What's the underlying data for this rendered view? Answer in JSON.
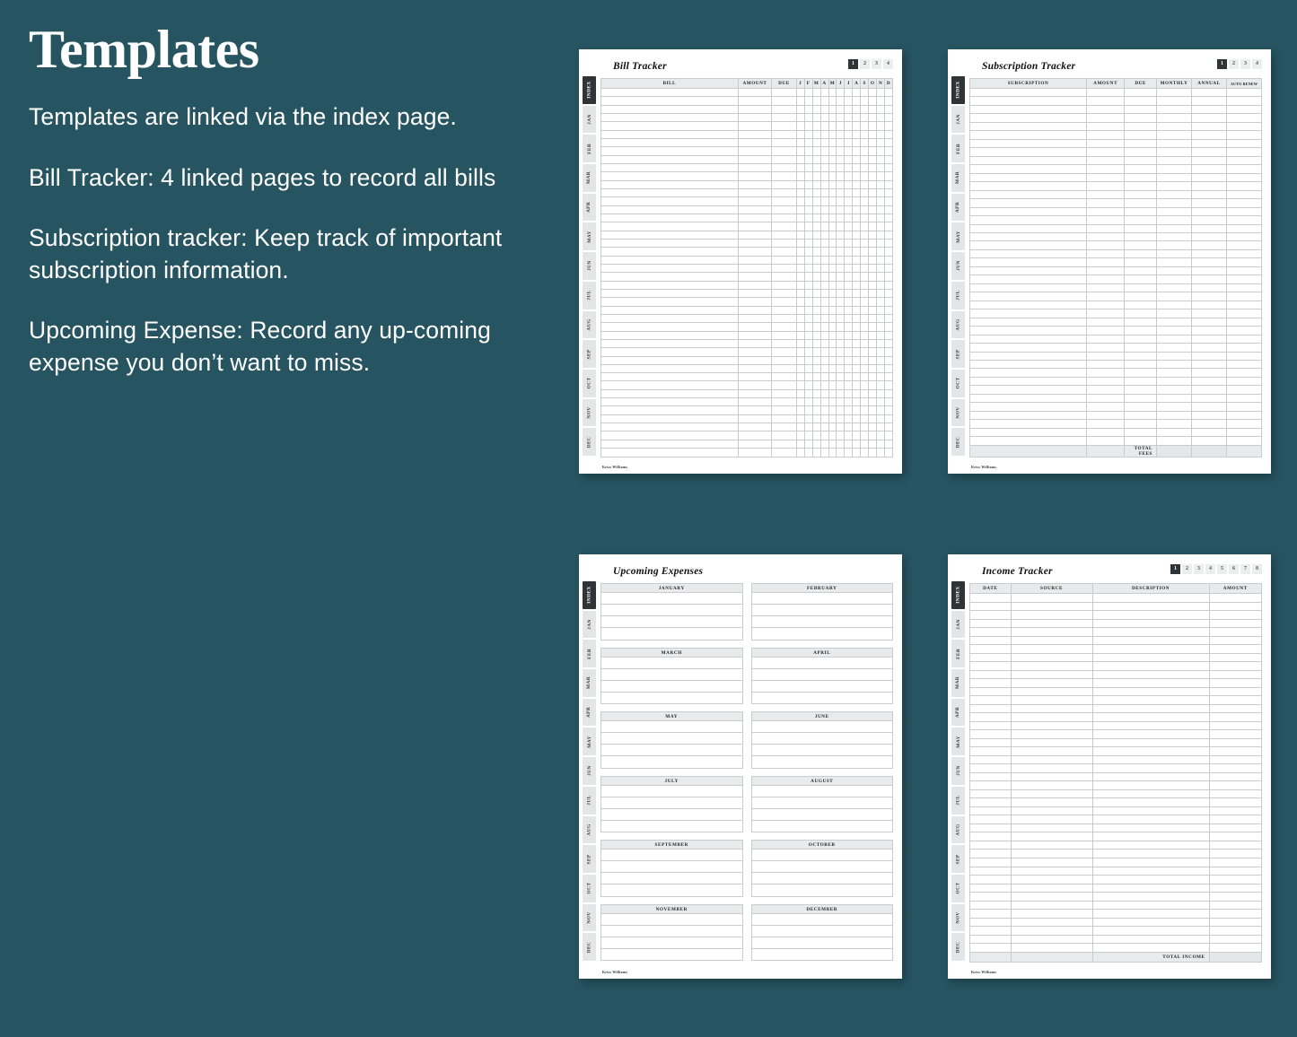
{
  "theme": {
    "background": "#265460",
    "text_on_background": "#ffffff",
    "paper": "#ffffff",
    "tab_active": "#2f3437",
    "tab_inactive": "#e3e5e7",
    "header_fill": "#e9eaeb",
    "shaded_fill": "#e4e6e7",
    "grid_line": "#c9cbcd"
  },
  "left_panel": {
    "title": "Templates",
    "paragraphs": [
      "Templates are linked via the index page.",
      "Bill Tracker: 4 linked pages to record all bills",
      "Subscription tracker: Keep track of important subscription information.",
      "Upcoming Expense: Record any up-coming  expense you don’t want to miss."
    ]
  },
  "side_tabs": [
    "INDEX",
    "JAN",
    "FEB",
    "MAR",
    "APR",
    "MAY",
    "JUN",
    "JUL",
    "AUG",
    "SEP",
    "OCT",
    "NOV",
    "DEC"
  ],
  "footer_note": "Kriss Williams",
  "pages": {
    "bill_tracker": {
      "title": "Bill Tracker",
      "page_tabs": [
        "1",
        "2",
        "3",
        "4"
      ],
      "active_page_tab": "1",
      "columns": [
        "BILL",
        "AMOUNT",
        "DUE"
      ],
      "month_columns": [
        "J",
        "F",
        "M",
        "A",
        "M",
        "J",
        "J",
        "A",
        "S",
        "O",
        "N",
        "D"
      ],
      "row_count": 44
    },
    "subscription_tracker": {
      "title": "Subscription Tracker",
      "page_tabs": [
        "1",
        "2",
        "3",
        "4"
      ],
      "active_page_tab": "1",
      "columns": [
        "SUBSCRIPTION",
        "AMOUNT",
        "DUE",
        "MONTHLY",
        "ANNUAL",
        "AUTO RENEW"
      ],
      "shaded_columns": [
        "MONTHLY",
        "ANNUAL"
      ],
      "row_count": 42,
      "total_label": "TOTAL FEES"
    },
    "upcoming_expenses": {
      "title": "Upcoming Expenses",
      "months": [
        "JANUARY",
        "FEBRUARY",
        "MARCH",
        "APRIL",
        "MAY",
        "JUNE",
        "JULY",
        "AUGUST",
        "SEPTEMBER",
        "OCTOBER",
        "NOVEMBER",
        "DECEMBER"
      ],
      "lines_per_month": 4
    },
    "income_tracker": {
      "title": "Income Tracker",
      "page_tabs": [
        "1",
        "2",
        "3",
        "4",
        "5",
        "6",
        "7",
        "8"
      ],
      "active_page_tab": "1",
      "columns": [
        "DATE",
        "SOURCE",
        "DESCRIPTION",
        "AMOUNT"
      ],
      "shaded_columns": [
        "AMOUNT"
      ],
      "row_count": 42,
      "total_label": "TOTAL INCOME"
    }
  }
}
